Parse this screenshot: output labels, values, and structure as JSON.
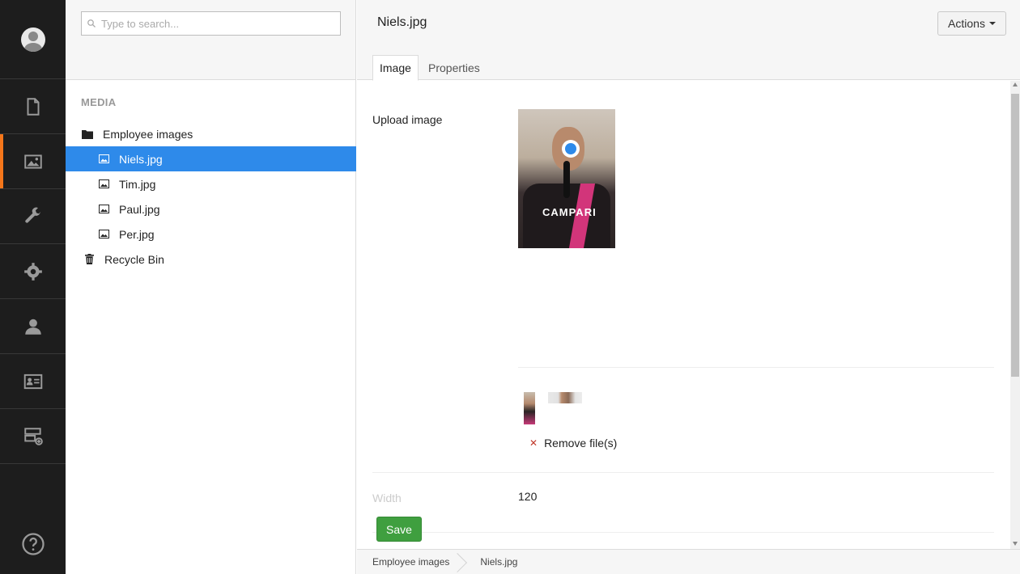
{
  "rail": {
    "items": [
      {
        "name": "content-icon"
      },
      {
        "name": "media-icon",
        "active": true
      },
      {
        "name": "settings-wrench-icon"
      },
      {
        "name": "developer-gear-icon"
      },
      {
        "name": "users-icon"
      },
      {
        "name": "members-icon"
      },
      {
        "name": "forms-icon"
      }
    ],
    "help_icon": "help-icon"
  },
  "tree": {
    "search_placeholder": "Type to search...",
    "section_title": "MEDIA",
    "folder_label": "Employee images",
    "items": [
      {
        "label": "Niels.jpg",
        "selected": true
      },
      {
        "label": "Tim.jpg"
      },
      {
        "label": "Paul.jpg"
      },
      {
        "label": "Per.jpg"
      }
    ],
    "recycle_label": "Recycle Bin"
  },
  "main": {
    "title": "Niels.jpg",
    "actions_label": "Actions",
    "tabs": [
      {
        "label": "Image",
        "active": true
      },
      {
        "label": "Properties"
      }
    ],
    "upload_label": "Upload image",
    "photo_text": "CAMPARI",
    "remove_label": "Remove file(s)",
    "width_label": "Width",
    "width_value": "120",
    "save_label": "Save"
  },
  "breadcrumb": [
    "Employee images",
    "Niels.jpg"
  ],
  "colors": {
    "accent": "#f5761a",
    "selected": "#2e8aea",
    "save": "#3f9f3f"
  }
}
